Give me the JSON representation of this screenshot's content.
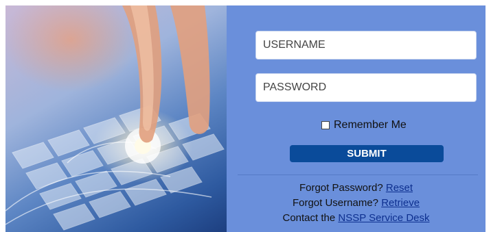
{
  "login": {
    "username_placeholder": "USERNAME",
    "password_placeholder": "PASSWORD",
    "remember_label": "Remember Me",
    "submit_label": "SUBMIT"
  },
  "help": {
    "forgot_password_text": "Forgot Password?",
    "reset_link": "Reset",
    "forgot_username_text": "Forgot Username?",
    "retrieve_link": "Retrieve",
    "contact_text": "Contact the",
    "service_desk_link": "NSSP Service Desk"
  },
  "colors": {
    "panel_bg": "#6a8fdb",
    "button_bg": "#0a4b9a",
    "link": "#0d2f8f"
  },
  "icons": {
    "remember": "checkbox-icon"
  }
}
